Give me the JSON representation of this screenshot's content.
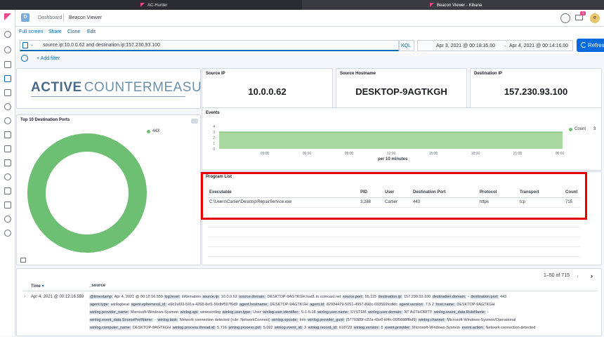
{
  "browser": {
    "tab1": "AC-Hunter",
    "tab2": "Beacon Viewer - Kibana"
  },
  "header": {
    "space_letter": "D",
    "breadcrumb_dashboard": "Dashboard",
    "breadcrumb_current": "Beacon Viewer",
    "notification_count": "1",
    "avatar_letter": "e"
  },
  "menu": {
    "full_screen": "Full screen",
    "share": "Share",
    "clone": "Clone",
    "edit": "Edit"
  },
  "query": {
    "value": "source.ip:10.0.0.62 and destination.ip:157.230.93.100",
    "language": "KQL",
    "start": "Apr 3, 2021 @ 00:18:35.00",
    "arrow": "→",
    "end": "Apr 4, 2021 @ 00:14:16.00",
    "refresh_label": "Refresh",
    "add_filter": "+ Add filter"
  },
  "logo": {
    "word1": "ACTIVE",
    "word2": "COUNTERMEASURES"
  },
  "metrics": {
    "source_ip": {
      "title": "Source IP",
      "value": "10.0.0.62"
    },
    "source_host": {
      "title": "Source Hostname",
      "value": "DESKTOP-9AGTKGH"
    },
    "dest_ip": {
      "title": "Destination IP",
      "value": "157.230.93.100"
    }
  },
  "donut": {
    "title": "Top 10 Destination Ports",
    "legend_label": "443",
    "color": "#6dbf73"
  },
  "events": {
    "title": "Events",
    "legend_label": "Count",
    "legend_value": "3",
    "xlabel": "per 10 minutes",
    "color": "#a8d8a0"
  },
  "chart_data": {
    "type": "area",
    "title": "Events",
    "xlabel": "per 10 minutes",
    "ylabel": "",
    "x_ticks": [
      "03:00",
      "06:00",
      "09:00",
      "12:00",
      "15:00",
      "18:00",
      "21:00",
      "00:00"
    ],
    "y_ticks": [
      "0",
      "1",
      "2",
      "3",
      "4"
    ],
    "ylim": [
      0,
      4
    ],
    "series": [
      {
        "name": "Count",
        "value": 3
      }
    ],
    "legend_position": "right"
  },
  "program_list": {
    "title": "Program List",
    "columns": [
      "Executable",
      "PID",
      "User",
      "Destination Port",
      "Protocol",
      "Transport",
      "Count"
    ],
    "rows": [
      [
        "C:\\Users\\Cartier\\Desktop\\RepairService.exe",
        "3,288",
        "Cartier",
        "443",
        "https",
        "tcp",
        "715"
      ]
    ]
  },
  "docs": {
    "pagination": "1–50 of 715",
    "col_time": "Time",
    "col_source": "_source",
    "row_time": "Apr 4, 2021 @ 00:12:16.559",
    "lines": [
      [
        [
          "@timestamp:",
          " Apr 4, 2021 @ 00:12:16.559 "
        ],
        [
          "log.level:",
          " information "
        ],
        [
          "source.ip:",
          " 10.0.0.62 "
        ],
        [
          "source.domain:",
          " DESKTOP-9AGTKGH.hsd1.tn.comcast.net "
        ],
        [
          "source.port:",
          " 55,115 "
        ],
        [
          "destination.ip:",
          " 157.230.93.100 "
        ],
        [
          "destination.domain:",
          " - "
        ],
        [
          "destination.port:",
          " 443"
        ]
      ],
      [
        [
          "agent.type:",
          " winlogbeat "
        ],
        [
          "agent.ephemeral_id:",
          " e6b2af33-591a-4268-8ef1-59dbf597f0d9 "
        ],
        [
          "agent.hostname:",
          " DESKTOP-9AGTKGH "
        ],
        [
          "agent.id:",
          " 82934479-5051-4957-890c-033566fcdfdc "
        ],
        [
          "agent.version:",
          " 7.5.2 "
        ],
        [
          "host.name:",
          " DESKTOP-9AGTKGH"
        ]
      ],
      [
        [
          "winlog.provider_name:",
          " Microsoft-Windows-Sysmon "
        ],
        [
          "winlog.api:",
          " wineventlog "
        ],
        [
          "winlog.user.type:",
          " User "
        ],
        [
          "winlog.user.identifier:",
          " S-1-5-18 "
        ],
        [
          "winlog.user.name:",
          " SYSTEM "
        ],
        [
          "winlog.user.domain:",
          " NT AUTHORITY "
        ],
        [
          "winlog.event_data.RuleName:",
          " -"
        ]
      ],
      [
        [
          "winlog.event_data.SourcePortName:",
          " - "
        ],
        [
          "winlog.task:",
          " Network connection detected (rule: NetworkConnect) "
        ],
        [
          "winlog.opcode:",
          " Info "
        ],
        [
          "winlog.provider_guid:",
          " {5770385f-c22a-43e0-bf4c-06f5698ffbd9} "
        ],
        [
          "winlog.channel:",
          " Microsoft-Windows-Sysmon/Operational"
        ]
      ],
      [
        [
          "winlog.computer_name:",
          " DESKTOP-9AGTKGH "
        ],
        [
          "winlog.process.thread.id:",
          " 5,716 "
        ],
        [
          "winlog.process.pid:",
          " 5,092 "
        ],
        [
          "winlog.event_id:",
          " 3 "
        ],
        [
          "winlog.record_id:",
          " 618723 "
        ],
        [
          "winlog.version:",
          " 5 "
        ],
        [
          "event.provider:",
          " Microsoft-Windows-Sysmon "
        ],
        [
          "event.action:",
          " Network connection detected"
        ]
      ]
    ]
  }
}
